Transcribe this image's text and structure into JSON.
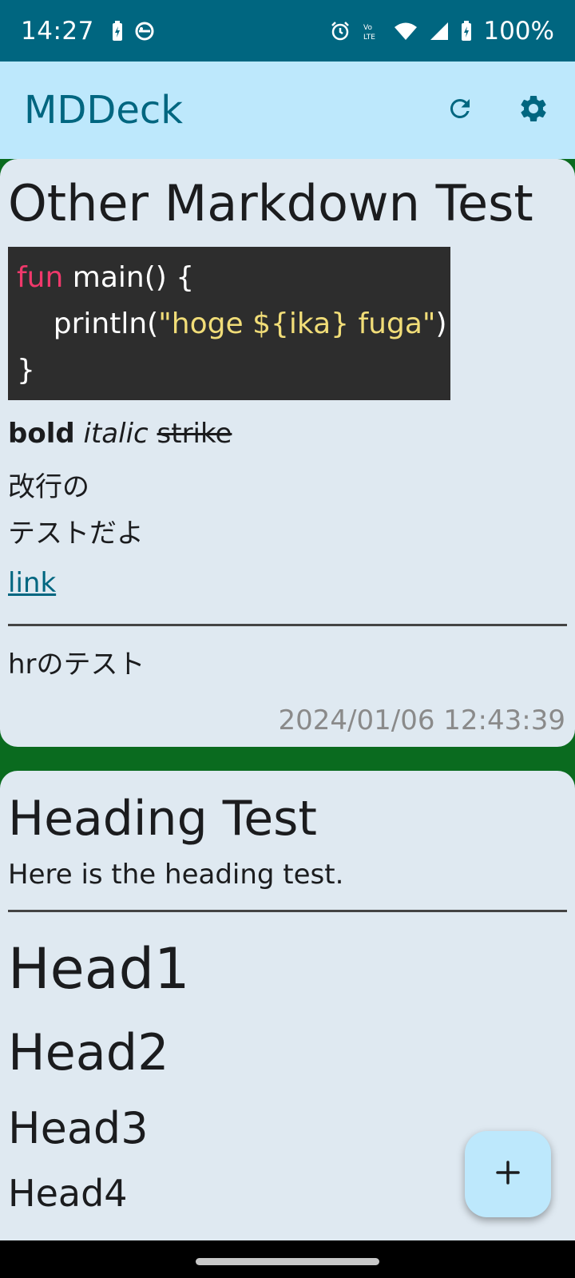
{
  "status_bar": {
    "time": "14:27",
    "battery": "100%",
    "icons": [
      "battery-saver-icon",
      "sync-icon",
      "alarm-icon",
      "volte-icon",
      "wifi-icon",
      "signal-icon",
      "battery-charging-icon"
    ]
  },
  "app_bar": {
    "title": "MDDeck",
    "actions": [
      "refresh-icon",
      "settings-icon"
    ]
  },
  "colors": {
    "status_bar": "#006680",
    "app_bar": "#bde8fc",
    "accent": "#006680",
    "card": "#dfe9f1",
    "background": "#0a6b1f",
    "code_bg": "#2d2d2d",
    "keyword": "#f0386b",
    "string": "#f1dd78"
  },
  "cards": [
    {
      "title": "Other Markdown Test",
      "code": {
        "keyword": "fun",
        "line1_rest": " main() {",
        "line2_indent": "    println(",
        "line2_string": "\"hoge ${ika} fuga\"",
        "line2_end": ")",
        "line3": "}"
      },
      "bold": "bold",
      "italic": "italic",
      "strike": "strike",
      "line1": "改行の",
      "line2": "テストだよ",
      "link": "link",
      "after_hr": "hrのテスト",
      "timestamp": "2024/01/06 12:43:39"
    },
    {
      "title": "Heading Test",
      "description": "Here is the heading test.",
      "h1": "Head1",
      "h2": "Head2",
      "h3": "Head3",
      "h4": "Head4"
    }
  ],
  "fab": {
    "icon": "plus-icon",
    "glyph": "+"
  }
}
